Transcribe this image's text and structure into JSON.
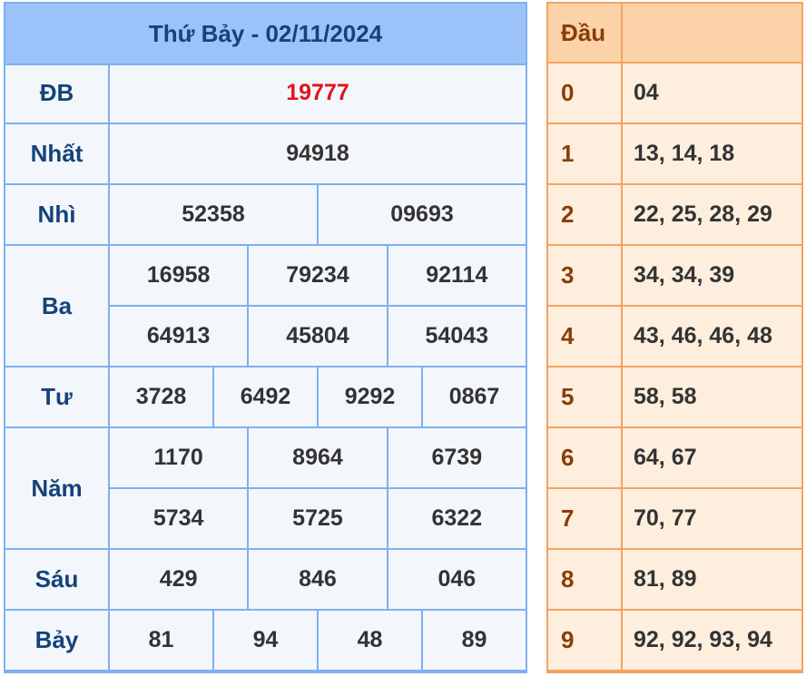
{
  "results": {
    "title": "Thứ Bảy - 02/11/2024",
    "prizes": [
      {
        "label": "ĐB",
        "rows": [
          [
            "19777"
          ]
        ],
        "special": true
      },
      {
        "label": "Nhất",
        "rows": [
          [
            "94918"
          ]
        ]
      },
      {
        "label": "Nhì",
        "rows": [
          [
            "52358",
            "09693"
          ]
        ]
      },
      {
        "label": "Ba",
        "rows": [
          [
            "16958",
            "79234",
            "92114"
          ],
          [
            "64913",
            "45804",
            "54043"
          ]
        ]
      },
      {
        "label": "Tư",
        "rows": [
          [
            "3728",
            "6492",
            "9292",
            "0867"
          ]
        ]
      },
      {
        "label": "Năm",
        "rows": [
          [
            "1170",
            "8964",
            "6739"
          ],
          [
            "5734",
            "5725",
            "6322"
          ]
        ]
      },
      {
        "label": "Sáu",
        "rows": [
          [
            "429",
            "846",
            "046"
          ]
        ]
      },
      {
        "label": "Bảy",
        "rows": [
          [
            "81",
            "94",
            "48",
            "89"
          ]
        ]
      }
    ]
  },
  "heads": {
    "header_label": "Đầu",
    "header_value": "",
    "rows": [
      {
        "digit": "0",
        "values": "04"
      },
      {
        "digit": "1",
        "values": "13, 14, 18"
      },
      {
        "digit": "2",
        "values": "22, 25, 28, 29"
      },
      {
        "digit": "3",
        "values": "34, 34, 39"
      },
      {
        "digit": "4",
        "values": "43, 46, 46, 48"
      },
      {
        "digit": "5",
        "values": "58, 58"
      },
      {
        "digit": "6",
        "values": "64, 67"
      },
      {
        "digit": "7",
        "values": "70, 77"
      },
      {
        "digit": "8",
        "values": "81, 89"
      },
      {
        "digit": "9",
        "values": "92, 92, 93, 94"
      }
    ]
  },
  "colors": {
    "special_prize": "#e0141e",
    "results_header": "#9cc3f9",
    "heads_header": "#fcd3a9"
  }
}
